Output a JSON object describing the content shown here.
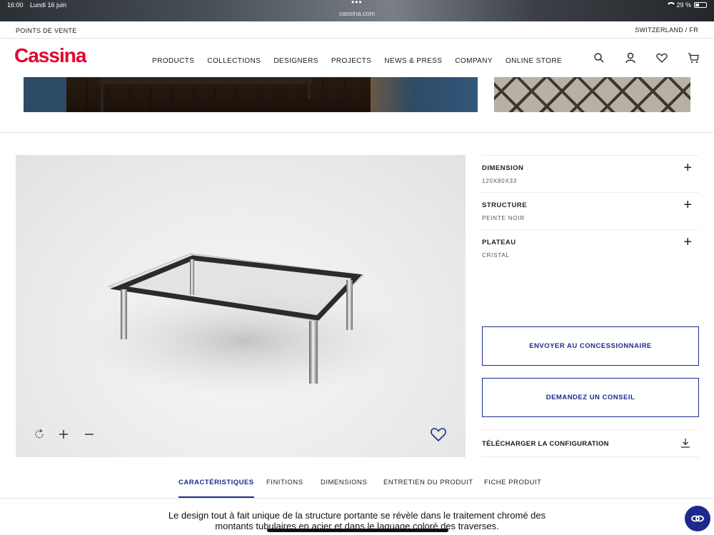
{
  "status_bar": {
    "time": "16:00",
    "date": "Lundi 16 juin",
    "url": "cassina.com",
    "battery": "29 %"
  },
  "utility": {
    "points_de_vente": "POINTS DE VENTE",
    "region": "SWITZERLAND / FR"
  },
  "header": {
    "logo": "Cassina",
    "nav": [
      "PRODUCTS",
      "COLLECTIONS",
      "DESIGNERS",
      "PROJECTS",
      "NEWS & PRESS",
      "COMPANY",
      "ONLINE STORE"
    ]
  },
  "options": [
    {
      "title": "DIMENSION",
      "value": "120X80X33"
    },
    {
      "title": "STRUCTURE",
      "value": "PEINTE NOIR"
    },
    {
      "title": "PLATEAU",
      "value": "CRISTAL"
    }
  ],
  "buttons": {
    "dealer": "ENVOYER AU CONCESSIONNAIRE",
    "advice": "DEMANDEZ UN CONSEIL"
  },
  "download": {
    "label": "TÉLÉCHARGER LA CONFIGURATION"
  },
  "tabs": [
    "CARACTÉRISTIQUES",
    "FINITIONS",
    "DIMENSIONS",
    "ENTRETIEN DU PRODUIT",
    "FICHE PRODUIT"
  ],
  "description": {
    "line1": "Le design tout à fait unique de la structure portante se révèle dans le traitement chromé des",
    "line2": "montants tubulaires en acier et dans le laquage coloré des traverses."
  },
  "colors": {
    "brand": "#e4032e",
    "accent": "#1d2a8c"
  }
}
